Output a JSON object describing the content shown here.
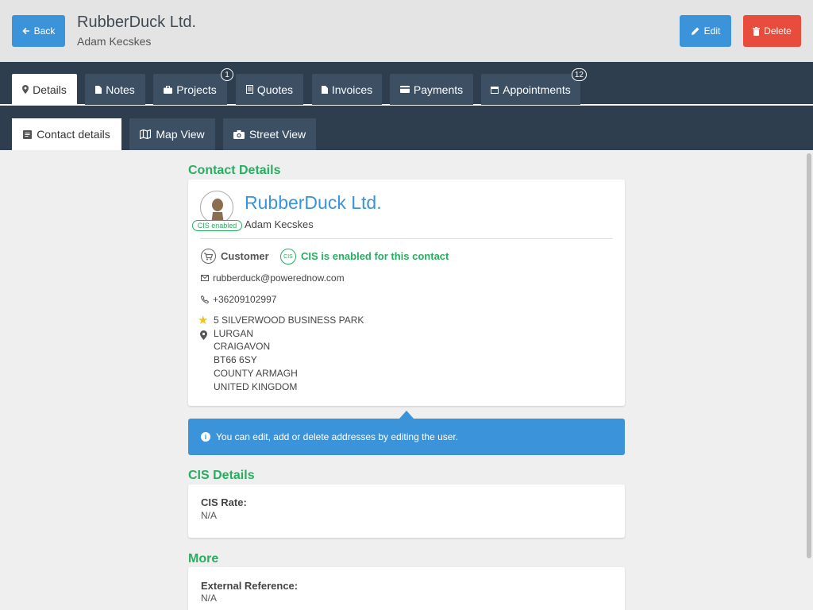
{
  "header": {
    "back_label": "Back",
    "title": "RubberDuck Ltd.",
    "subtitle": "Adam Kecskes",
    "edit_label": "Edit",
    "delete_label": "Delete"
  },
  "tabs": [
    {
      "label": "Details",
      "icon": "map-pin-icon"
    },
    {
      "label": "Notes",
      "icon": "note-icon"
    },
    {
      "label": "Projects",
      "icon": "briefcase-icon",
      "badge": "1"
    },
    {
      "label": "Quotes",
      "icon": "quote-document-icon"
    },
    {
      "label": "Invoices",
      "icon": "invoice-icon"
    },
    {
      "label": "Payments",
      "icon": "credit-card-icon"
    },
    {
      "label": "Appointments",
      "icon": "calendar-icon",
      "badge": "12"
    }
  ],
  "subtabs": [
    {
      "label": "Contact details",
      "icon": "contact-card-icon"
    },
    {
      "label": "Map View",
      "icon": "map-icon"
    },
    {
      "label": "Street View",
      "icon": "camera-icon"
    }
  ],
  "contact_section": {
    "title": "Contact Details",
    "cis_badge": "CIS enabled",
    "name": "RubberDuck Ltd.",
    "person": "Adam Kecskes",
    "type": "Customer",
    "cis_icon_text": "CIS",
    "cis_status": "CIS is enabled for this contact",
    "email": "rubberduck@powerednow.com",
    "phone": "+36209102997",
    "address": [
      "5 SILVERWOOD BUSINESS PARK",
      "LURGAN",
      "CRAIGAVON",
      "BT66 6SY",
      "COUNTY ARMAGH",
      "UNITED KINGDOM"
    ]
  },
  "info_message": "You can edit, add or delete addresses by editing the user.",
  "cis_section": {
    "title": "CIS Details",
    "rate_label": "CIS Rate:",
    "rate_value": "N/A"
  },
  "more_section": {
    "title": "More",
    "ext_ref_label": "External Reference:",
    "ext_ref_value": "N/A"
  },
  "colors": {
    "primary": "#3b93d9",
    "danger": "#e74c3c",
    "success": "#27ae60",
    "nav": "#2e3e4e",
    "tab": "#3c4f63"
  }
}
